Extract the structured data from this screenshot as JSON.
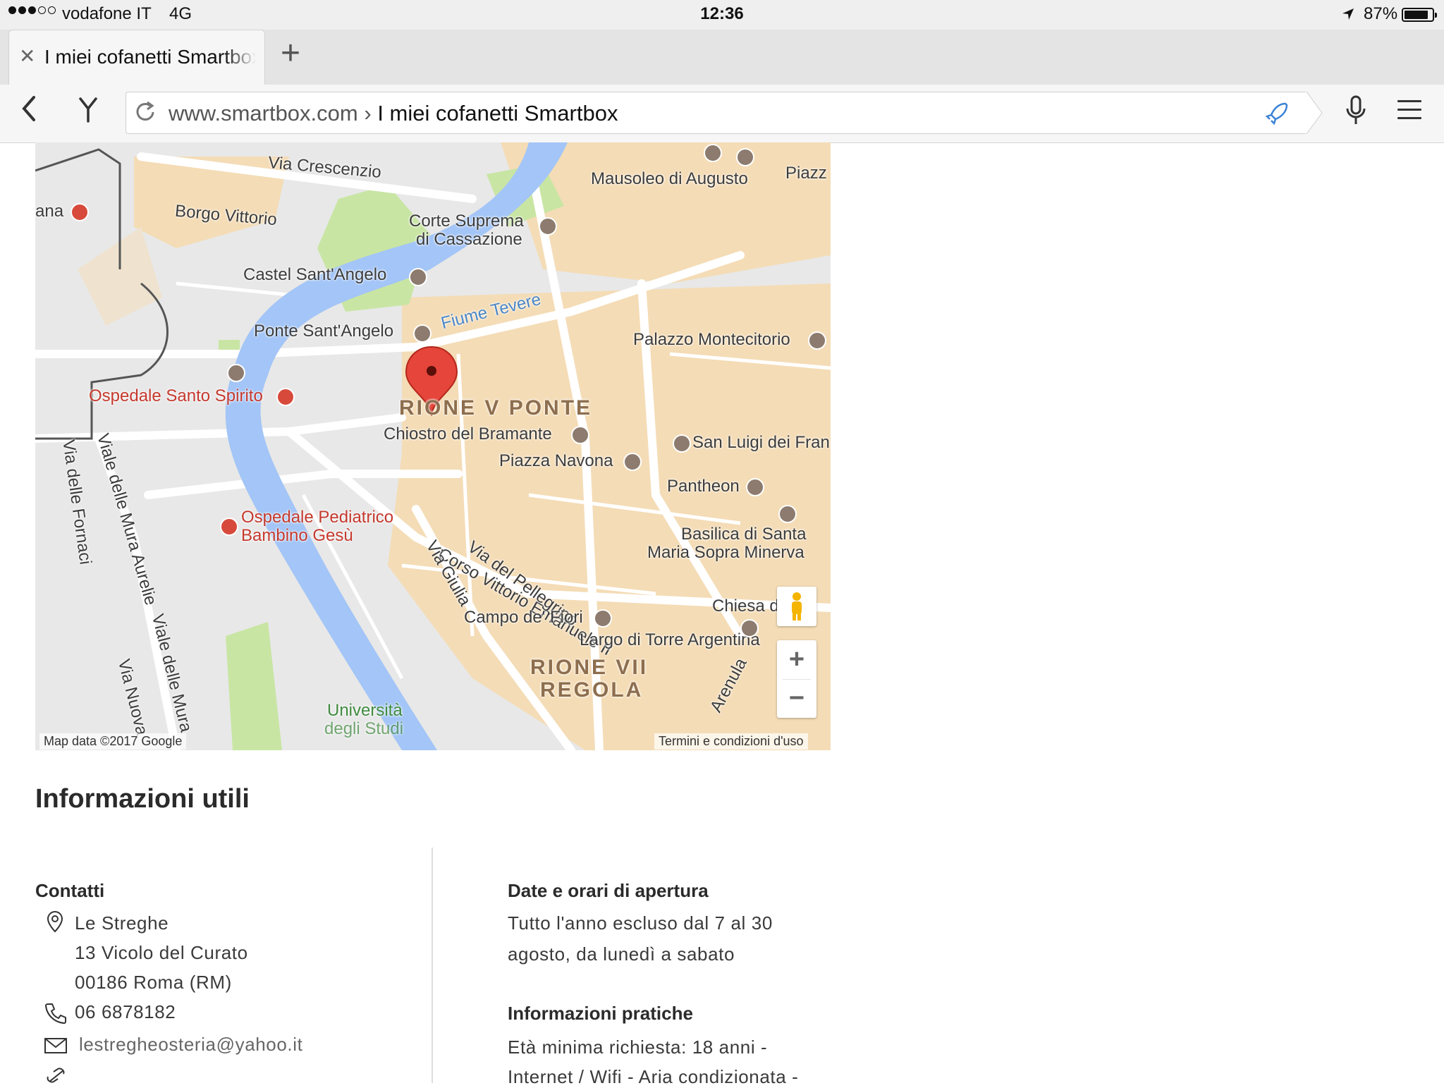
{
  "status_bar": {
    "carrier": "vodafone IT",
    "network": "4G",
    "time": "12:36",
    "battery_percent": "87%",
    "battery_level": 0.87
  },
  "tabs": [
    {
      "title": "I miei cofanetti Smartbox"
    }
  ],
  "address_bar": {
    "domain": "www.smartbox.com",
    "separator": "›",
    "page_title": "I miei cofanetti Smartbox"
  },
  "map": {
    "labels": {
      "via_crescenzio": "Via Crescenzio",
      "borgo_vittorio": "Borgo Vittorio",
      "mausoleo": "Mausoleo di Augusto",
      "piazz": "Piazz",
      "corte_suprema_1": "Corte Suprema",
      "corte_suprema_2": "di Cassazione",
      "castel": "Castel Sant'Angelo",
      "fiume": "Fiume Tevere",
      "ponte": "Ponte Sant'Angelo",
      "palazzo": "Palazzo Montecitorio",
      "ospedale_ss": "Ospedale Santo Spirito",
      "rione_v": "RIONE V PONTE",
      "chiostro": "Chiostro del Bramante",
      "san_luigi": "San Luigi dei Fran",
      "navona": "Piazza Navona",
      "pantheon": "Pantheon",
      "basilica_1": "Basilica di Santa",
      "basilica_2": "Maria Sopra Minerva",
      "bambino_1": "Ospedale Pediatrico",
      "bambino_2": "Bambino Gesù",
      "corso": "Corso Vittorio Emanuele II",
      "pellegrino": "Via del Pellegrino",
      "giulia": "Via Giulia",
      "fornaci": "Via delle Fornaci",
      "mura_aurelie": "Viale delle Mura Aurelie",
      "mura_2": "Viale delle Mura",
      "via_nuova": "Via Nuova",
      "chiesa": "Chiesa d",
      "campo": "Campo de' Fiori",
      "largo": "Largo di Torre Argentina",
      "rione_vii_1": "RIONE VII",
      "rione_vii_2": "REGOLA",
      "universita_1": "Università",
      "universita_2": "degli Studi",
      "arenula": "Arenula",
      "ana": "ana"
    },
    "footer_left": "Map data ©2017 Google",
    "footer_right": "Termini e condizioni d'uso",
    "zoom_in": "+",
    "zoom_out": "−",
    "colors": {
      "river": "#a3c5f7",
      "park": "#c9e5a4",
      "built": "#f4dcb6",
      "road": "#ffffff",
      "marker": "#e5453a"
    }
  },
  "info": {
    "heading": "Informazioni utili",
    "contacts_title": "Contatti",
    "address_line1": "Le Streghe",
    "address_line2": "13 Vicolo del Curato",
    "address_line3": "00186 Roma (RM)",
    "phone": "06 6878182",
    "email": "lestregheosteria@yahoo.it",
    "hours_title": "Date e orari di apertura",
    "hours_line1": "Tutto l'anno escluso dal 7 al 30",
    "hours_line2": "agosto, da lunedì a sabato",
    "practical_title": "Informazioni pratiche",
    "practical_line1": "Età minima richiesta: 18 anni -",
    "practical_line2": "Internet / Wifi - Aria condizionata -"
  },
  "icons": [
    "signal-dots-icon",
    "location-arrow-icon",
    "battery-icon",
    "close-tab-icon",
    "new-tab-icon",
    "back-icon",
    "yandex-icon",
    "reload-icon",
    "rocket-icon",
    "microphone-icon",
    "menu-icon",
    "map-marker-icon",
    "pegman-icon",
    "location-pin-icon",
    "phone-icon",
    "email-icon",
    "link-icon"
  ]
}
